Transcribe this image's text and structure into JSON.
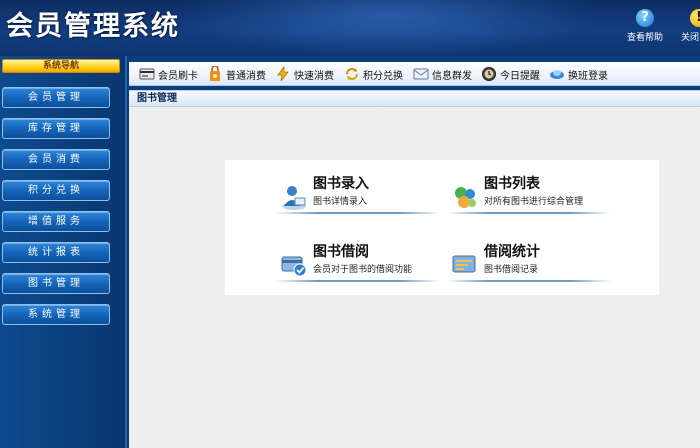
{
  "header": {
    "title": "会员管理系统",
    "help_label": "查看帮助",
    "close_label": "关闭系统",
    "help_glyph": "?",
    "close_glyph": "!"
  },
  "sidebar": {
    "nav_header": "系统导航",
    "items": [
      {
        "label": "会员管理"
      },
      {
        "label": "库存管理"
      },
      {
        "label": "会员消费"
      },
      {
        "label": "积分兑换"
      },
      {
        "label": "增值服务"
      },
      {
        "label": "统计报表"
      },
      {
        "label": "图书管理"
      },
      {
        "label": "系统管理"
      }
    ]
  },
  "toolbar": {
    "items": [
      {
        "label": "会员刷卡",
        "icon": "card-reader-icon"
      },
      {
        "label": "普通消费",
        "icon": "shopping-icon"
      },
      {
        "label": "快速消费",
        "icon": "lightning-icon"
      },
      {
        "label": "积分兑换",
        "icon": "exchange-icon"
      },
      {
        "label": "信息群发",
        "icon": "message-icon"
      },
      {
        "label": "今日提醒",
        "icon": "clock-icon"
      },
      {
        "label": "换班登录",
        "icon": "switch-shift-icon"
      }
    ]
  },
  "breadcrumb": "图书管理",
  "cards": [
    {
      "title": "图书录入",
      "desc": "图书详情录入",
      "icon": "book-entry-icon"
    },
    {
      "title": "图书列表",
      "desc": "对所有图书进行综合管理",
      "icon": "book-list-icon"
    },
    {
      "title": "图书借阅",
      "desc": "会员对于图书的借阅功能",
      "icon": "book-borrow-icon"
    },
    {
      "title": "借阅统计",
      "desc": "图书借阅记录",
      "icon": "borrow-stats-icon"
    }
  ],
  "colors": {
    "header_bg": "#123f82",
    "sidebar_bg": "#0b3f7c",
    "nav_button": "#1565b9",
    "nav_header": "#ffd11a",
    "content_bg": "#efefef"
  }
}
